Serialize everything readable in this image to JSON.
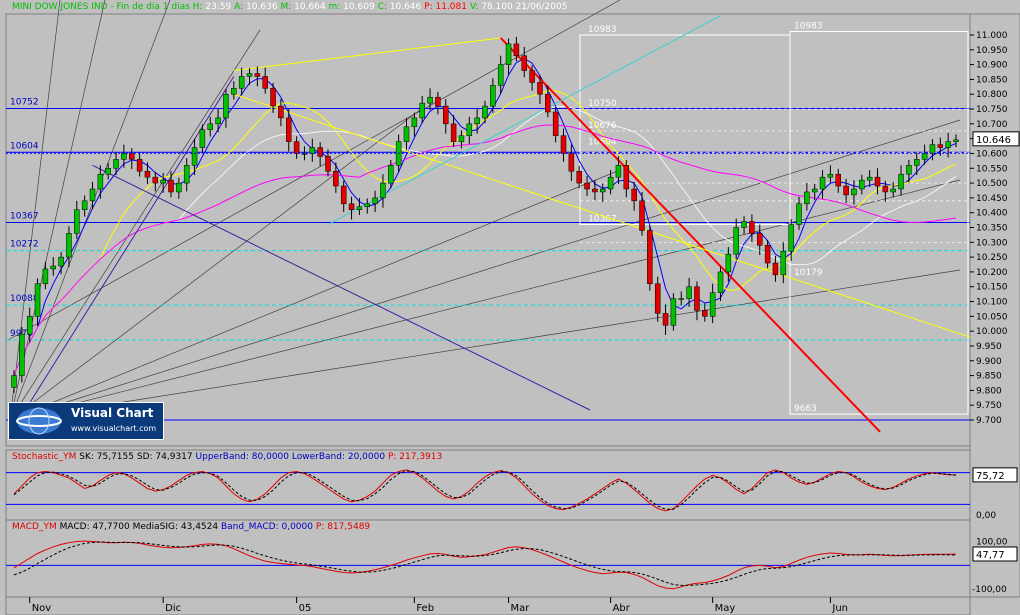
{
  "header": {
    "instrument": "MINI DOW JONES IND",
    "interval": "Fin de dia 1 dias",
    "h_label": "H:",
    "h_value": "23:59",
    "a_label": "A:",
    "a_value": "10.636",
    "m_label": "M:",
    "m_value": "10.664",
    "in_label": "m:",
    "in_value": "10.609",
    "c_label": "C:",
    "c_value": "10.646",
    "p_label": "P:",
    "p_value": "11.081",
    "v_label": "V:",
    "v_value": "78.100",
    "date": "21/06/2005"
  },
  "logo": {
    "title": "Visual Chart",
    "url": "www.visualchart.com"
  },
  "colors": {
    "background": "#c0c0c0",
    "bull": "#00c000",
    "bear": "#e00000",
    "level": "#0000ff",
    "cyan_level": "#00e0e0",
    "fan": "#404040",
    "trend_red": "#ff0000",
    "ma_yellow": "#ffff00",
    "ma_magenta": "#ff00ff",
    "ma_white": "#ffffff",
    "ma_blue": "#0000ff"
  },
  "chart_data": [
    {
      "type": "candlestick",
      "ylim": [
        9700,
        11000
      ],
      "y_ticks": [
        "11.000",
        "10.950",
        "10.900",
        "10.850",
        "10.800",
        "10.750",
        "10.700",
        "10.650",
        "10.600",
        "10.550",
        "10.500",
        "10.450",
        "10.400",
        "10.350",
        "10.300",
        "10.250",
        "10.200",
        "10.150",
        "10.100",
        "10.050",
        "10.000",
        "9.950",
        "9.900",
        "9.850",
        "9.800",
        "9.750",
        "9.700"
      ],
      "last_price_label": "10.646",
      "x_labels": [
        "Nov",
        "Dic",
        "05",
        "Feb",
        "Mar",
        "Abr",
        "May",
        "Jun"
      ],
      "close": [
        9850,
        9990,
        10050,
        10160,
        10210,
        10220,
        10250,
        10330,
        10410,
        10440,
        10480,
        10530,
        10550,
        10580,
        10600,
        10580,
        10540,
        10520,
        10500,
        10510,
        10470,
        10500,
        10560,
        10620,
        10680,
        10700,
        10720,
        10800,
        10820,
        10860,
        10870,
        10860,
        10820,
        10760,
        10720,
        10640,
        10600,
        10600,
        10620,
        10590,
        10540,
        10490,
        10430,
        10410,
        10420,
        10430,
        10450,
        10500,
        10560,
        10640,
        10690,
        10720,
        10770,
        10790,
        10760,
        10700,
        10640,
        10660,
        10700,
        10720,
        10760,
        10830,
        10900,
        10970,
        10930,
        10880,
        10840,
        10800,
        10740,
        10660,
        10600,
        10540,
        10500,
        10480,
        10470,
        10480,
        10520,
        10560,
        10480,
        10440,
        10340,
        10160,
        10060,
        10020,
        10110,
        10110,
        10150,
        10070,
        10050,
        10130,
        10200,
        10260,
        10350,
        10370,
        10330,
        10290,
        10230,
        10190,
        10270,
        10360,
        10430,
        10470,
        10480,
        10520,
        10530,
        10490,
        10460,
        10480,
        10510,
        10520,
        10490,
        10470,
        10480,
        10530,
        10560,
        10580,
        10600,
        10630,
        10620,
        10640,
        10646
      ],
      "levels": [
        10752,
        10604,
        10367,
        10272,
        10088,
        9970
      ],
      "level_labels": [
        "10752",
        "10604",
        "10367",
        "10272",
        "10088",
        "9970"
      ],
      "fib_labels_left": [
        {
          "text": "10983",
          "v": 11000
        },
        {
          "text": "10750",
          "v": 10750
        },
        {
          "text": "10676",
          "v": 10676
        },
        {
          "text": "10604",
          "v": 10620
        },
        {
          "text": "10367",
          "v": 10360
        }
      ],
      "fib_labels_right": [
        {
          "text": "10983",
          "v": 11012
        },
        {
          "text": "10179",
          "v": 10180
        },
        {
          "text": "9663",
          "v": 9720
        }
      ]
    },
    {
      "type": "line",
      "title": "Stochastic_YM",
      "readout": [
        {
          "label": "SK:",
          "value": "75,7155"
        },
        {
          "label": "SD:",
          "value": "74,9317"
        },
        {
          "label": "UpperBand:",
          "value": "80,0000"
        },
        {
          "label": "LowerBand:",
          "value": "20,0000"
        },
        {
          "label": "P:",
          "value": "217,3913"
        }
      ],
      "ylim": [
        0,
        100
      ],
      "y_ticks": [
        "75,72",
        "0,00"
      ],
      "bands": [
        80,
        20
      ],
      "series": [
        {
          "name": "SK",
          "values": [
            40,
            55,
            70,
            80,
            82,
            80,
            75,
            70,
            60,
            50,
            55,
            65,
            75,
            80,
            78,
            70,
            60,
            50,
            45,
            48,
            55,
            65,
            75,
            80,
            82,
            78,
            70,
            55,
            40,
            30,
            25,
            30,
            40,
            55,
            70,
            80,
            82,
            78,
            70,
            60,
            50,
            40,
            30,
            25,
            28,
            35,
            45,
            60,
            75,
            82,
            85,
            80,
            70,
            58,
            45,
            35,
            30,
            35,
            45,
            60,
            72,
            80,
            84,
            80,
            70,
            55,
            40,
            28,
            18,
            12,
            10,
            15,
            22,
            30,
            40,
            50,
            60,
            68,
            60,
            48,
            35,
            22,
            12,
            8,
            12,
            25,
            40,
            55,
            68,
            75,
            70,
            60,
            48,
            40,
            50,
            65,
            80,
            85,
            80,
            70,
            62,
            58,
            62,
            70,
            78,
            82,
            80,
            72,
            62,
            55,
            50,
            48,
            52,
            60,
            68,
            74,
            78,
            80,
            78,
            76,
            75.7
          ]
        },
        {
          "name": "SD",
          "values": [
            38,
            50,
            62,
            74,
            80,
            81,
            78,
            73,
            65,
            56,
            54,
            60,
            70,
            77,
            78,
            74,
            66,
            56,
            48,
            47,
            52,
            60,
            70,
            77,
            80,
            79,
            73,
            61,
            47,
            35,
            28,
            28,
            35,
            47,
            62,
            74,
            80,
            80,
            74,
            65,
            55,
            45,
            35,
            28,
            27,
            31,
            40,
            52,
            67,
            78,
            83,
            82,
            74,
            63,
            51,
            40,
            33,
            33,
            40,
            53,
            66,
            76,
            82,
            81,
            74,
            61,
            46,
            33,
            22,
            15,
            12,
            13,
            19,
            27,
            36,
            46,
            56,
            64,
            62,
            52,
            40,
            28,
            17,
            11,
            11,
            20,
            33,
            48,
            61,
            71,
            71,
            64,
            53,
            44,
            47,
            59,
            74,
            82,
            82,
            74,
            66,
            60,
            61,
            67,
            75,
            80,
            80,
            75,
            66,
            58,
            52,
            49,
            51,
            57,
            65,
            71,
            76,
            79,
            78,
            77,
            74.9
          ]
        }
      ]
    },
    {
      "type": "line",
      "title": "MACD_YM",
      "readout": [
        {
          "label": "MACD:",
          "value": "47,7700"
        },
        {
          "label": "MediaSIG:",
          "value": "43,4524"
        },
        {
          "label": "Band_MACD:",
          "value": "0,0000"
        },
        {
          "label": "P:",
          "value": "817,5489"
        }
      ],
      "ylim": [
        -120,
        140
      ],
      "y_ticks": [
        "100,00",
        "47,77",
        "-100,00"
      ],
      "bands": [
        0
      ],
      "series": [
        {
          "name": "MACD",
          "values": [
            -10,
            10,
            30,
            50,
            65,
            78,
            88,
            95,
            100,
            102,
            100,
            98,
            95,
            95,
            97,
            96,
            92,
            86,
            80,
            76,
            74,
            75,
            78,
            82,
            88,
            90,
            88,
            82,
            70,
            55,
            40,
            28,
            18,
            12,
            8,
            5,
            2,
            0,
            -5,
            -12,
            -18,
            -25,
            -30,
            -32,
            -30,
            -25,
            -18,
            -10,
            0,
            10,
            22,
            32,
            40,
            48,
            50,
            46,
            38,
            34,
            36,
            40,
            45,
            55,
            65,
            75,
            78,
            74,
            66,
            55,
            42,
            28,
            14,
            0,
            -12,
            -22,
            -30,
            -35,
            -32,
            -28,
            -30,
            -38,
            -50,
            -68,
            -85,
            -95,
            -98,
            -90,
            -80,
            -75,
            -72,
            -65,
            -55,
            -42,
            -25,
            -10,
            -2,
            0,
            -4,
            -10,
            -5,
            8,
            22,
            34,
            42,
            48,
            52,
            50,
            46,
            44,
            45,
            47,
            45,
            42,
            40,
            41,
            43,
            45,
            46,
            47,
            47,
            47,
            47.8
          ]
        },
        {
          "name": "SIG",
          "values": [
            -40,
            -28,
            -12,
            8,
            26,
            44,
            60,
            74,
            84,
            92,
            96,
            98,
            97,
            96,
            96,
            96,
            95,
            92,
            88,
            84,
            80,
            78,
            77,
            78,
            81,
            84,
            86,
            85,
            80,
            72,
            62,
            50,
            40,
            30,
            22,
            15,
            10,
            6,
            2,
            -3,
            -8,
            -14,
            -20,
            -25,
            -28,
            -28,
            -26,
            -21,
            -14,
            -6,
            4,
            14,
            24,
            33,
            40,
            43,
            42,
            40,
            39,
            39,
            41,
            46,
            53,
            61,
            68,
            71,
            70,
            66,
            58,
            48,
            37,
            25,
            13,
            2,
            -8,
            -17,
            -23,
            -26,
            -27,
            -30,
            -36,
            -46,
            -58,
            -70,
            -80,
            -84,
            -84,
            -82,
            -79,
            -75,
            -69,
            -61,
            -50,
            -38,
            -27,
            -18,
            -13,
            -12,
            -10,
            -5,
            2,
            11,
            20,
            29,
            36,
            41,
            43,
            44,
            44,
            45,
            45,
            44,
            43,
            42,
            42,
            43,
            44,
            44,
            45,
            45,
            43.5
          ]
        }
      ]
    }
  ]
}
